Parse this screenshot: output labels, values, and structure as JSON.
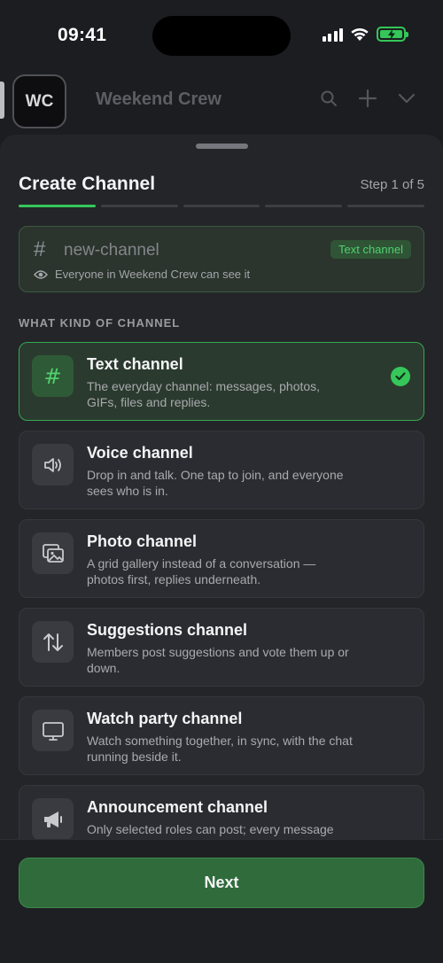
{
  "status_bar": {
    "time": "09:41",
    "icons": [
      "signal-icon",
      "wifi-icon",
      "battery-charging-icon"
    ],
    "battery_color": "#35c759"
  },
  "background": {
    "server_initials": "WC",
    "server_name": "Weekend Crew",
    "header_icons": [
      "search-icon",
      "plus-icon",
      "chevron-down-icon"
    ]
  },
  "sheet": {
    "title": "Create Channel",
    "step_label": "Step 1 of 5",
    "progress": {
      "total_steps": 5,
      "current_step": 1
    },
    "accent_color": "#35c759",
    "channel_preview": {
      "prefix_icon": "hash-icon",
      "name_placeholder": "new-channel",
      "type_badge": "Text channel",
      "visibility_icon": "eye-icon",
      "visibility_text": "Everyone in Weekend Crew can see it"
    },
    "section_label": "WHAT KIND OF CHANNEL",
    "options": [
      {
        "icon": "hash-icon",
        "title": "Text channel",
        "description": "The everyday channel: messages, photos, GIFs, files and replies.",
        "selected": true
      },
      {
        "icon": "speaker-icon",
        "title": "Voice channel",
        "description": "Drop in and talk. One tap to join, and everyone sees who is in.",
        "selected": false
      },
      {
        "icon": "photo-gallery-icon",
        "title": "Photo channel",
        "description": "A grid gallery instead of a conversation — photos first, replies underneath.",
        "selected": false
      },
      {
        "icon": "up-down-arrows-icon",
        "title": "Suggestions channel",
        "description": "Members post suggestions and vote them up or down.",
        "selected": false
      },
      {
        "icon": "monitor-icon",
        "title": "Watch party channel",
        "description": "Watch something together, in sync, with the chat running beside it.",
        "selected": false
      },
      {
        "icon": "megaphone-icon",
        "title": "Announcement channel",
        "description": "Only selected roles can post; every message",
        "selected": false
      }
    ],
    "next_label": "Next"
  }
}
